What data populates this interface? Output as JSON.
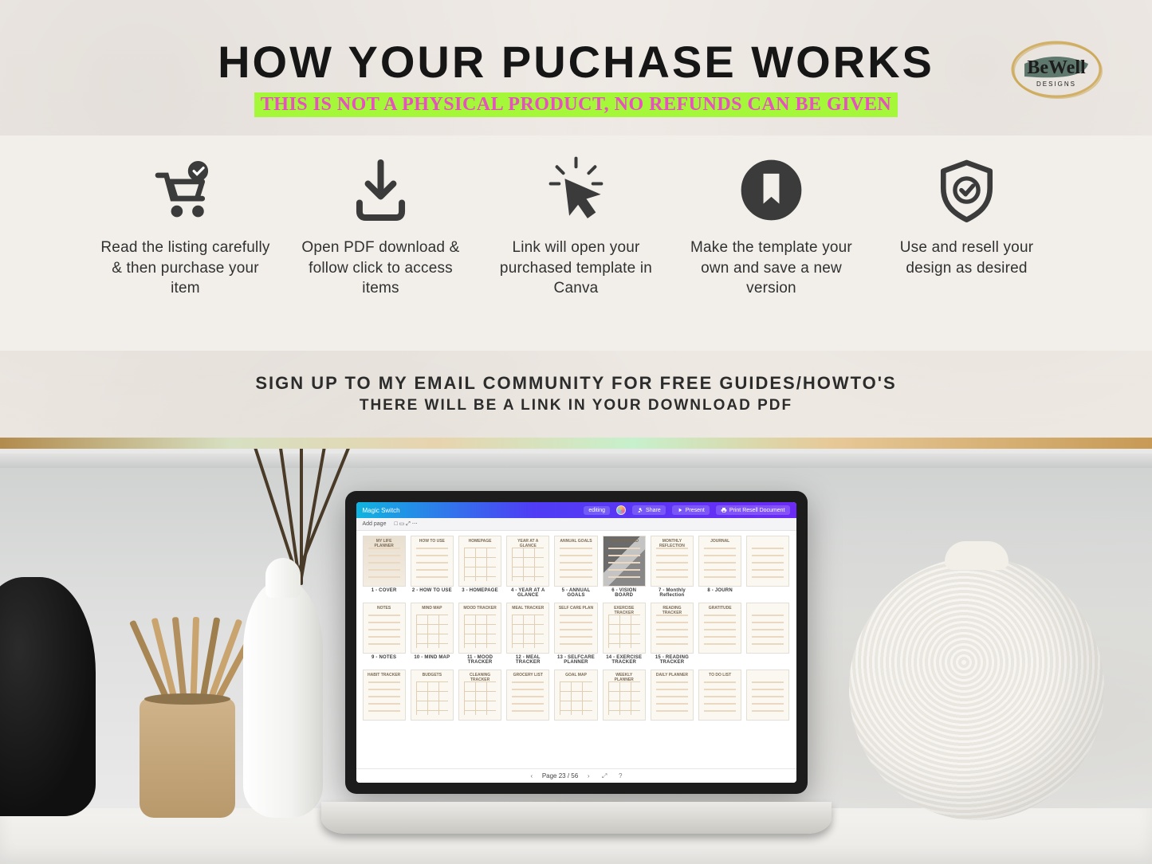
{
  "brand": {
    "name": "BeWell",
    "tag": "DESIGNS"
  },
  "header": {
    "title": "HOW YOUR PUCHASE WORKS",
    "subtitle": "THIS IS NOT A PHYSICAL PRODUCT, NO REFUNDS CAN BE GIVEN"
  },
  "steps": [
    {
      "icon": "cart-check-icon",
      "text": "Read the listing carefully & then purchase your item"
    },
    {
      "icon": "download-icon",
      "text": "Open PDF download & follow click to access items"
    },
    {
      "icon": "cursor-click-icon",
      "text": "Link will open your purchased template in Canva"
    },
    {
      "icon": "bookmark-icon",
      "text": "Make the template your own and save a new version"
    },
    {
      "icon": "shield-check-icon",
      "text": "Use and resell your design as desired"
    }
  ],
  "community": {
    "line1": "SIGN UP TO MY EMAIL COMMUNITY FOR FREE GUIDES/HOWTO'S",
    "line2": "THERE WILL BE A LINK IN YOUR DOWNLOAD PDF"
  },
  "laptop": {
    "app_title_left": "Magic Switch",
    "toolbar": {
      "add_page": "Add page",
      "icons": "□ ▭ ⤢ ⋯"
    },
    "top_right": {
      "autosave": "editing",
      "share": "Share",
      "present": "Present",
      "print": "Print Resell Document"
    },
    "status": {
      "page_label": "Page 23 / 56",
      "prev": "‹",
      "next": "›",
      "zoom": "⤢",
      "help": "?"
    },
    "rows": [
      [
        {
          "page_title": "MY LIFE PLANNER",
          "style": "cover",
          "label": "1 - COVER"
        },
        {
          "page_title": "HOW TO USE",
          "style": "text",
          "label": "2 - HOW TO USE"
        },
        {
          "page_title": "HOMEPAGE",
          "style": "grid",
          "label": "3 - HOMEPAGE"
        },
        {
          "page_title": "YEAR AT A GLANCE",
          "style": "grid",
          "label": "4 - YEAR AT A GLANCE"
        },
        {
          "page_title": "ANNUAL GOALS",
          "style": "text",
          "label": "5 - ANNUAL GOALS"
        },
        {
          "page_title": "VISION BOARD",
          "style": "photo",
          "label": "6 - VISION BOARD"
        },
        {
          "page_title": "MONTHLY REFLECTION",
          "style": "text",
          "label": "7 - Monthly Reflection"
        },
        {
          "page_title": "JOURNAL",
          "style": "text",
          "label": "8 - JOURN"
        },
        {
          "page_title": "",
          "style": "text",
          "label": ""
        }
      ],
      [
        {
          "page_title": "NOTES",
          "style": "text",
          "label": "9 - NOTES"
        },
        {
          "page_title": "MIND MAP",
          "style": "grid",
          "label": "10 - MIND MAP"
        },
        {
          "page_title": "MOOD TRACKER",
          "style": "grid",
          "label": "11 - MOOD TRACKER"
        },
        {
          "page_title": "MEAL TRACKER",
          "style": "grid",
          "label": "12 - MEAL TRACKER"
        },
        {
          "page_title": "SELF CARE PLAN",
          "style": "text",
          "label": "13 - SELFCARE PLANNER"
        },
        {
          "page_title": "EXERCISE TRACKER",
          "style": "grid",
          "label": "14 - EXERCISE TRACKER"
        },
        {
          "page_title": "READING TRACKER",
          "style": "text",
          "label": "15 - READING TRACKER"
        },
        {
          "page_title": "GRATITUDE",
          "style": "text",
          "label": ""
        },
        {
          "page_title": "",
          "style": "text",
          "label": ""
        }
      ],
      [
        {
          "page_title": "HABIT TRACKER",
          "style": "text",
          "label": ""
        },
        {
          "page_title": "BUDGETS",
          "style": "grid",
          "label": ""
        },
        {
          "page_title": "CLEANING TRACKER",
          "style": "grid",
          "label": ""
        },
        {
          "page_title": "GROCERY LIST",
          "style": "text",
          "label": ""
        },
        {
          "page_title": "GOAL MAP",
          "style": "grid",
          "label": ""
        },
        {
          "page_title": "WEEKLY PLANNER",
          "style": "grid",
          "label": ""
        },
        {
          "page_title": "DAILY PLANNER",
          "style": "text",
          "label": ""
        },
        {
          "page_title": "TO DO LIST",
          "style": "text",
          "label": ""
        },
        {
          "page_title": "",
          "style": "text",
          "label": ""
        }
      ]
    ]
  }
}
